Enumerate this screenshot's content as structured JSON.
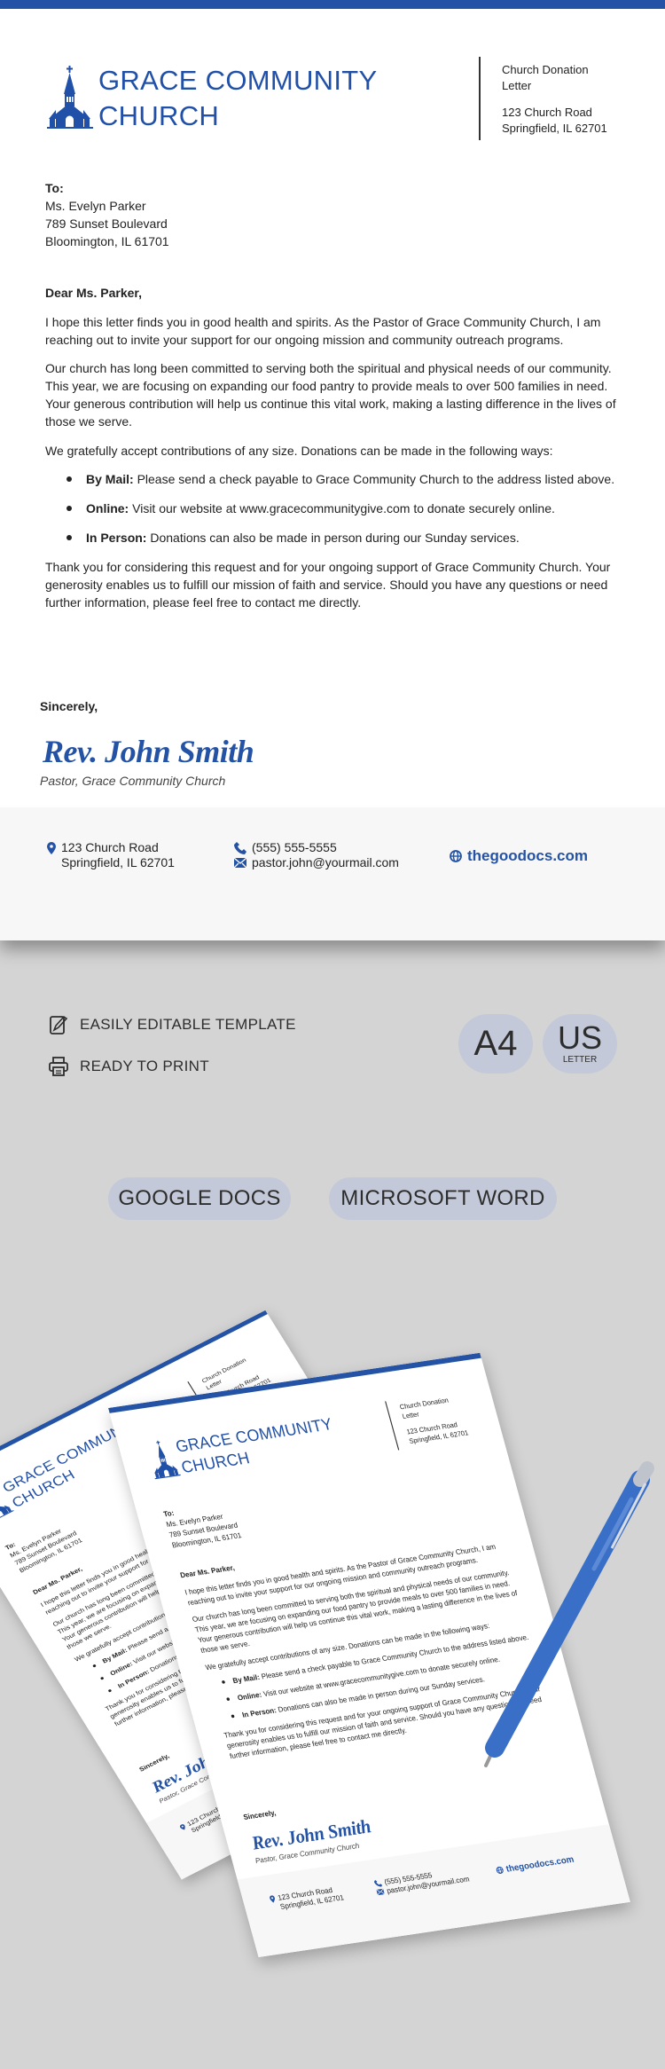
{
  "brand_color": "#2453a6",
  "header": {
    "title_line1": "GRACE COMMUNITY",
    "title_line2": "CHURCH",
    "doc_type_line1": "Church Donation",
    "doc_type_line2": "Letter",
    "address_line1": "123 Church Road",
    "address_line2": "Springfield, IL 62701"
  },
  "recipient": {
    "label": "To:",
    "name": "Ms. Evelyn Parker",
    "street": "789 Sunset Boulevard",
    "city": "Bloomington, IL 61701"
  },
  "letter": {
    "salutation": "Dear Ms. Parker,",
    "paragraphs": [
      "I hope this letter finds you in good health and spirits. As the Pastor of Grace Community Church, I am reaching out to invite your support for our ongoing mission and community outreach programs.",
      "Our church has long been committed to serving both the spiritual and physical needs of our community. This year, we are focusing on expanding our food pantry to provide meals to over 500 families in need. Your generous contribution will help us continue this vital work, making a lasting difference in the lives of those we serve.",
      "We gratefully accept contributions of any size. Donations can be made in the following ways:"
    ],
    "methods": [
      {
        "label": "By Mail:",
        "text": " Please send a check payable to Grace Community Church to the address listed above."
      },
      {
        "label": "Online:",
        "text": " Visit our website at www.gracecommunitygive.com to donate securely online."
      },
      {
        "label": "In Person:",
        "text": " Donations can also be made in person during our Sunday services."
      }
    ],
    "closing_paragraph": "Thank you for considering this request and for your ongoing support of Grace Community Church. Your generosity enables us to fulfill our mission of faith and service. Should you have any questions or need further information, please feel free to contact me directly.",
    "sign_off": "Sincerely,",
    "signature": "Rev. John Smith",
    "signer_title": "Pastor, Grace Community Church"
  },
  "footer": {
    "address_line1": "123 Church Road",
    "address_line2": "Springfield, IL 62701",
    "phone": "(555) 555-5555",
    "email": "pastor.john@yourmail.com",
    "website": "thegoodocs.com"
  },
  "features": [
    {
      "icon": "edit-icon",
      "label": "EASILY EDITABLE TEMPLATE"
    },
    {
      "icon": "printer-icon",
      "label": "READY TO PRINT"
    }
  ],
  "sizes": {
    "a4": "A4",
    "us": "US",
    "us_sub": "LETTER"
  },
  "formats": [
    "GOOGLE DOCS",
    "MICROSOFT WORD"
  ]
}
